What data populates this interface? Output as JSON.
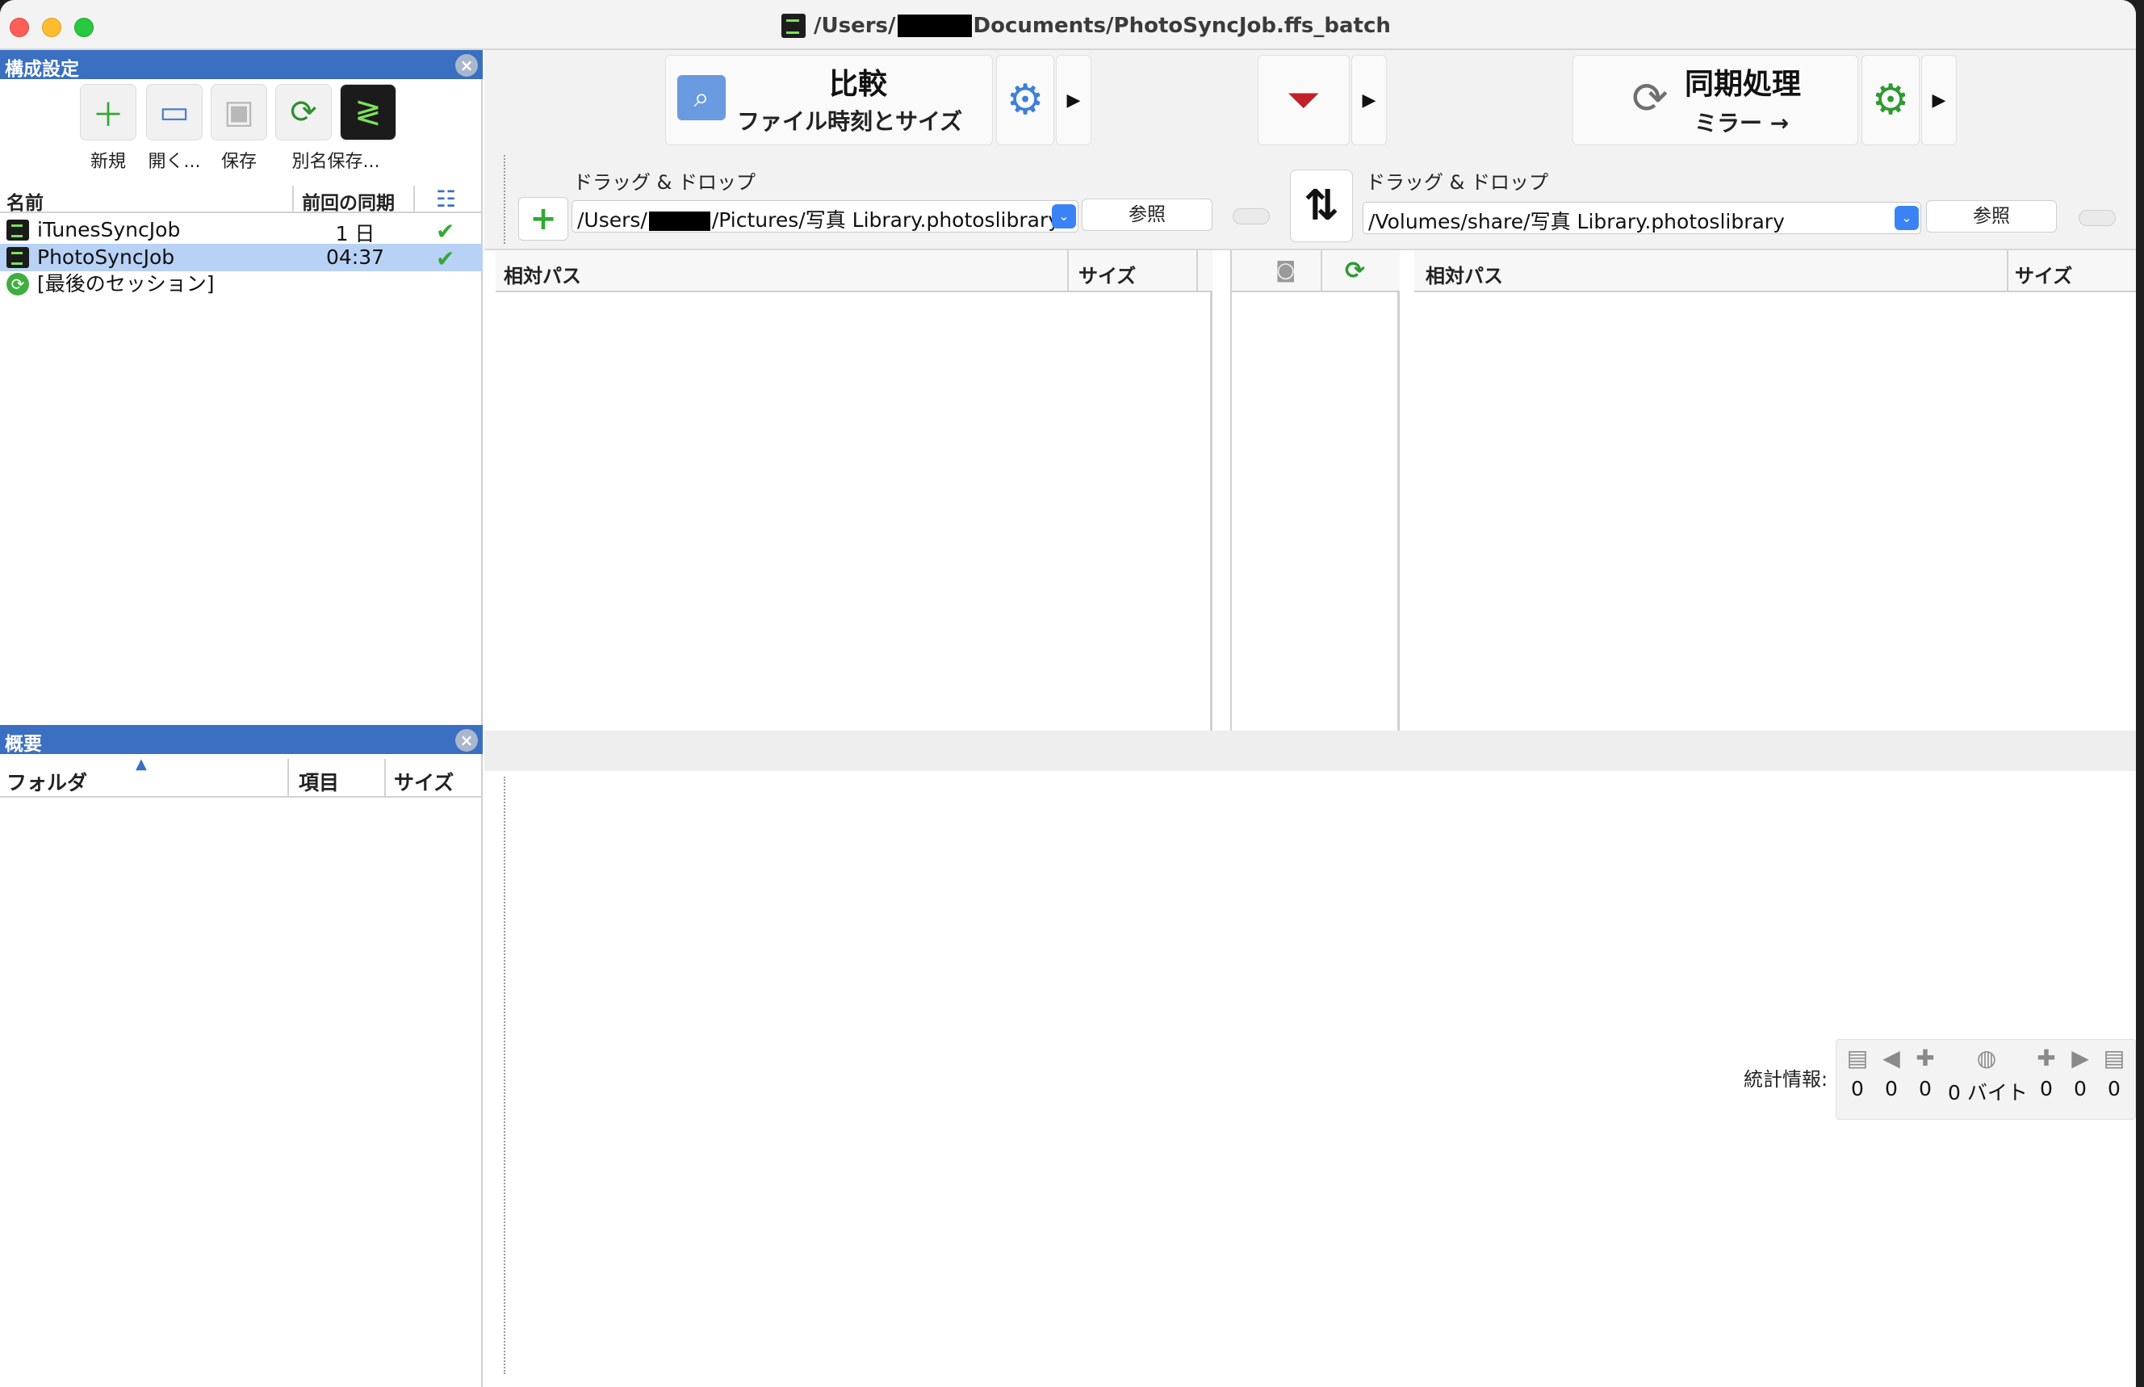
{
  "window": {
    "title_prefix": "/Users/",
    "title_suffix": "Documents/PhotoSyncJob.ffs_batch"
  },
  "config_panel": {
    "header": "構成設定",
    "toolbar": {
      "new_label": "新規",
      "open_label": "開く...",
      "save_label": "保存",
      "save_as_label": "別名保存..."
    },
    "columns": {
      "name": "名前",
      "last_sync": "前回の同期"
    },
    "jobs": [
      {
        "name": "iTunesSyncJob",
        "last_sync": "1 日",
        "status": "ok"
      },
      {
        "name": "PhotoSyncJob",
        "last_sync": "04:37",
        "status": "ok",
        "selected": true
      }
    ],
    "last_session_label": "[最後のセッション]"
  },
  "summary_panel": {
    "header": "概要",
    "columns": {
      "folder": "フォルダ",
      "items": "項目",
      "size": "サイズ"
    }
  },
  "toolbar": {
    "compare": {
      "title": "比較",
      "subtitle": "ファイル時刻とサイズ"
    },
    "sync": {
      "title": "同期処理",
      "subtitle": "ミラー →"
    }
  },
  "left_folder": {
    "drop_label": "ドラッグ & ドロップ",
    "path_prefix": "/Users/",
    "path_suffix": "/Pictures/写真 Library.photoslibrary",
    "browse_label": "参照"
  },
  "right_folder": {
    "drop_label": "ドラッグ & ドロップ",
    "path": "/Volumes/share/写真 Library.photoslibrary",
    "browse_label": "参照"
  },
  "left_grid": {
    "col_path": "相対パス",
    "col_size": "サイズ"
  },
  "right_grid": {
    "col_path": "相対パス",
    "col_size": "サイズ"
  },
  "statistics": {
    "label": "統計情報:",
    "values": [
      "0",
      "0",
      "0",
      "0 バイト",
      "0",
      "0",
      "0"
    ]
  },
  "colors": {
    "panel_header": "#3a6fc1",
    "selection": "#b7d2f5",
    "sync_green": "#35a834",
    "filter_red": "#c0202a",
    "accent_blue": "#3b82f6"
  }
}
